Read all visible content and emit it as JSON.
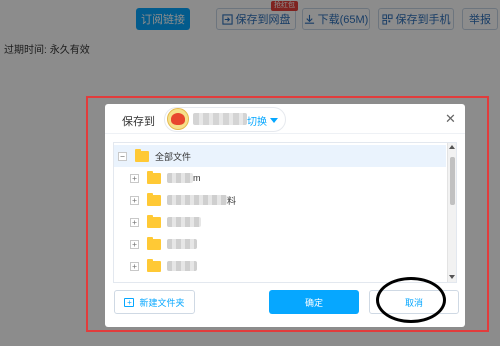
{
  "header": {
    "subscribe_label": "订阅链接",
    "save_to_cloud_label": "保存到网盘",
    "hot_badge": "抢红包",
    "download_label": "下载(65M)",
    "save_to_phone_label": "保存到手机",
    "report_label": "举报"
  },
  "expire": {
    "label": "过期时间:",
    "value": "永久有效"
  },
  "dialog": {
    "title": "保存到",
    "switch_label": "切换",
    "close_icon": "✕",
    "tree": {
      "root_label": "全部文件",
      "items": [
        {
          "toggle": "+",
          "suffix": "m"
        },
        {
          "toggle": "+",
          "suffix": "料"
        },
        {
          "toggle": "+",
          "suffix": ""
        },
        {
          "toggle": "+",
          "suffix": ""
        },
        {
          "toggle": "+",
          "suffix": ""
        }
      ]
    },
    "new_folder_label": "新建文件夹",
    "confirm_label": "确定",
    "cancel_label": "取消"
  },
  "colors": {
    "accent": "#06a7ff",
    "highlight": "#e23c3c",
    "folder": "#ffc935"
  }
}
